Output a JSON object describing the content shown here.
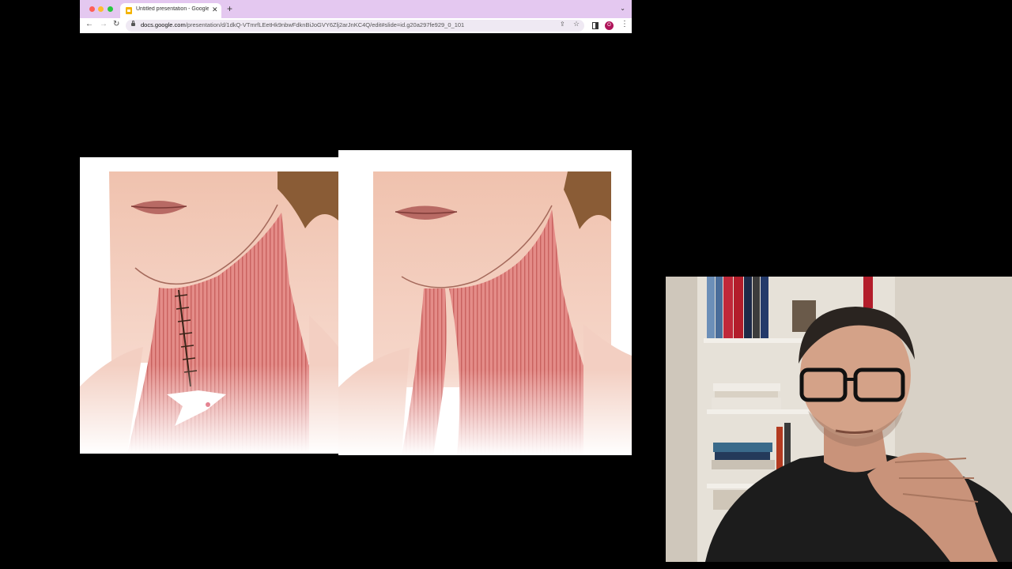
{
  "browser": {
    "tab_title": "Untitled presentation - Google",
    "tab_close": "✕",
    "new_tab": "+",
    "tab_menu": "⌄",
    "back": "←",
    "forward": "→",
    "reload": "↻",
    "url_host": "docs.google.com",
    "url_path": "/presentation/d/1dkQ-VTmrfLEetHk9nbwFdknBiJoGVY6Zlj2arJnKC4Q/edit#slide=id.g20a297fe929_0_101",
    "share": "⇪",
    "bookmark_star": "☆",
    "profile_initial": "O",
    "menu": "⋮"
  },
  "colors": {
    "tabbar": "#e4c8f0",
    "muscle": "#e58f8c",
    "skin": "#f2c8b8",
    "stitch": "#3a2418"
  },
  "slide": {
    "left_image": "neck-platysma-plication-illustration",
    "right_image": "neck-platysma-banding-illustration"
  },
  "webcam": {
    "subject": "presenter-video"
  }
}
